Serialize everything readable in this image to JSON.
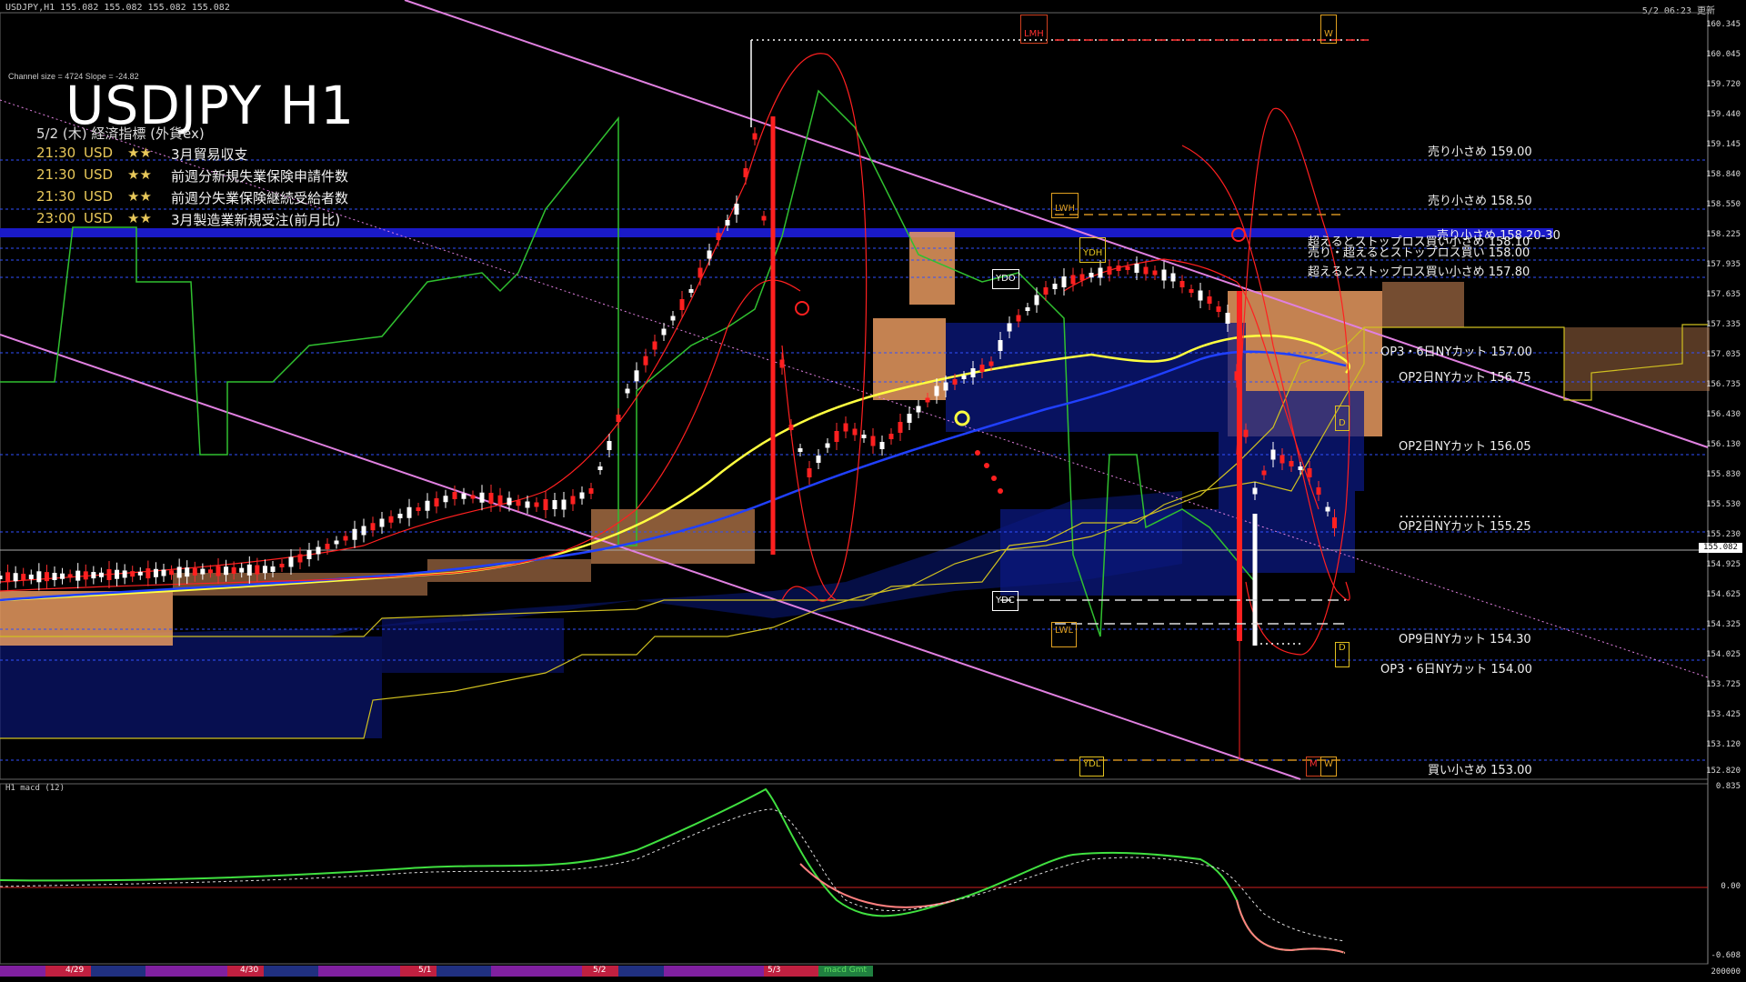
{
  "window": {
    "header_left": "USDJPY,H1  155.082 155.082 155.082 155.082",
    "header_right": "5/2 06:23 更新"
  },
  "title": "USDJPY H1",
  "channel_info": "Channel size = 4724 Slope = -24.82",
  "indicator_header": "5/2 (木) 経済指標 (外貨ex)",
  "events": [
    {
      "time": "21:30",
      "currency": "USD",
      "stars": "★★",
      "name": "3月貿易収支"
    },
    {
      "time": "21:30",
      "currency": "USD",
      "stars": "★★",
      "name": "前週分新規失業保険申請件数"
    },
    {
      "time": "21:30",
      "currency": "USD",
      "stars": "★★",
      "name": "前週分失業保険継続受給者数"
    },
    {
      "time": "23:00",
      "currency": "USD",
      "stars": "★★",
      "name": "3月製造業新規受注(前月比)"
    }
  ],
  "levels": [
    "売り小さめ 159.00",
    "売り小さめ 158.50",
    "売り小さめ 158.20-30",
    "超えるとストップロス買い小さめ 158.10",
    "売り・超えるとストップロス買い 158.00",
    "超えるとストップロス買い小さめ 157.80",
    "OP3・6日NYカット 157.00",
    "OP2日NYカット 156.75",
    "OP2日NYカット 156.05",
    "OP2日NYカット 155.25",
    "OP9日NYカット 154.30",
    "OP3・6日NYカット 154.00",
    "買い小さめ 153.00"
  ],
  "tags": [
    "LMH",
    "W",
    "LWH",
    "YDH",
    "YDO",
    "YDC",
    "LWL",
    "D",
    "D",
    "YDL",
    "M",
    "W"
  ],
  "price_axis": [
    "160.345",
    "160.045",
    "159.720",
    "159.440",
    "159.145",
    "158.840",
    "158.550",
    "158.225",
    "157.935",
    "157.635",
    "157.335",
    "157.035",
    "156.735",
    "156.430",
    "156.130",
    "155.830",
    "155.530",
    "155.230",
    "154.925",
    "154.625",
    "154.325",
    "154.025",
    "153.725",
    "153.425",
    "153.120",
    "152.820"
  ],
  "current_price": "155.082",
  "macd": {
    "title": "H1  macd (12)",
    "axis": [
      "0.835",
      "0.00",
      "-0.608",
      "200000"
    ]
  },
  "time_axis": [
    "4/29",
    "4/30",
    "5/1",
    "5/2",
    "5/3",
    "macd Gmt"
  ],
  "colors": {
    "background": "#000000",
    "up_candle": "#ffffff",
    "down_candle": "#ff2020",
    "channel": "#e080e0",
    "cloud": "#f0a060",
    "ma_yellow": "#ffff40",
    "ma_blue": "#2040ff",
    "bollinger": "#ff2020",
    "green_line": "#30c030",
    "macd_main": "#40e040",
    "macd_neg": "#ff8080"
  }
}
